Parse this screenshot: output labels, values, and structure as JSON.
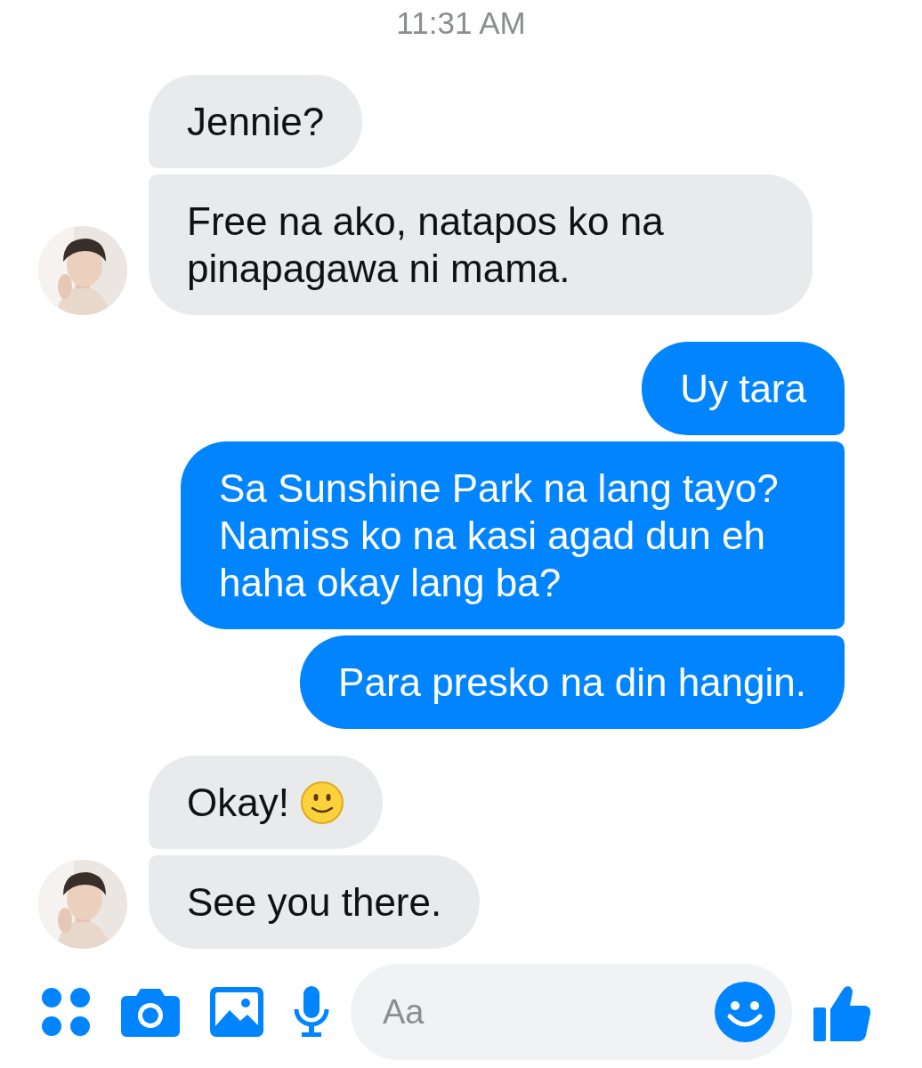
{
  "timestamp": "11:31 AM",
  "messages": [
    {
      "kind": "incoming",
      "text": "Jennie?",
      "avatar": false,
      "emoji": false
    },
    {
      "kind": "incoming",
      "text": "Free na ako, natapos ko na pinapagawa ni mama.",
      "avatar": true,
      "emoji": false
    },
    {
      "kind": "outgoing",
      "text": "Uy tara",
      "avatar": false,
      "emoji": false
    },
    {
      "kind": "outgoing",
      "text": "Sa Sunshine Park na lang tayo? Namiss ko na kasi agad dun eh haha okay lang ba?",
      "avatar": false,
      "emoji": false
    },
    {
      "kind": "outgoing",
      "text": "Para presko na din hangin.",
      "avatar": false,
      "emoji": false
    },
    {
      "kind": "incoming",
      "text": "Okay!",
      "avatar": false,
      "emoji": true
    },
    {
      "kind": "incoming",
      "text": "See you there.",
      "avatar": true,
      "emoji": false
    }
  ],
  "composer": {
    "placeholder": "Aa"
  }
}
